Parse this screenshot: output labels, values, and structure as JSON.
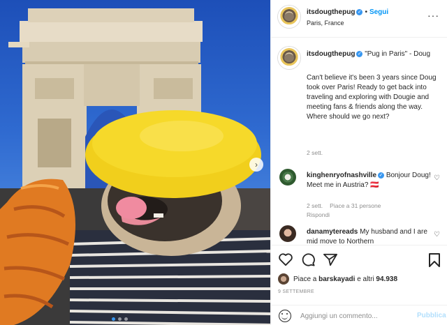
{
  "post": {
    "username": "itsdougthepug",
    "follow_label": "Segui",
    "location": "Paris, France",
    "caption_quote": "\"Pug in Paris\" - Doug",
    "caption_body": "Can't believe it's been 3 years since Doug took over Paris! Ready to get back into traveling and exploring with Dougie and meeting fans & friends along the way. Where should we go next?",
    "caption_time": "2 sett."
  },
  "comments": [
    {
      "username": "kinghenryofnashville",
      "text": "Bonjour Doug! Meet me in Austria? 🇦🇹",
      "time": "2 sett.",
      "likes": "Piace a 31 persone",
      "reply": "Rispondi"
    },
    {
      "username": "danamytereads",
      "text": "My husband and I are mid move to Northern"
    }
  ],
  "likes_line": {
    "prefix": "Piace a",
    "user": "barskayadi",
    "suffix": "e altri",
    "count": "94.938"
  },
  "date": "9 SETTEMBRE",
  "add_comment": {
    "placeholder": "Aggiungi un commento...",
    "publish_label": "Pubblica"
  },
  "colors": {
    "accent": "#0095f6",
    "publish_disabled": "#b2dffc",
    "meta_gray": "#8e8e8e"
  }
}
